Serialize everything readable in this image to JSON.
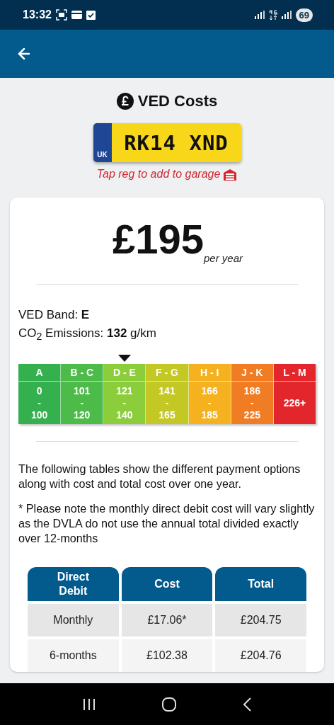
{
  "status_bar": {
    "time": "13:32",
    "battery": "69"
  },
  "header": {
    "title": "VED Costs",
    "registration": "RK14 XND",
    "country": "UK",
    "hint": "Tap reg to add to garage"
  },
  "price": {
    "amount": "£195",
    "period": "per year"
  },
  "band_info": {
    "band": "VED Band: **E**",
    "emissions": "CO$_{2}$ Emissions: **132** g/km"
  },
  "bands": [
    {
      "label": "A",
      "from": "0",
      "dash": "-",
      "to": "100",
      "color": "#35b04f",
      "selected": false
    },
    {
      "label": "B - C",
      "from": "101",
      "dash": "-",
      "to": "120",
      "color": "#4dbb4a",
      "selected": false
    },
    {
      "label": "D - E",
      "from": "121",
      "dash": "-",
      "to": "140",
      "color": "#8ccd3c",
      "selected": true
    },
    {
      "label": "F - G",
      "from": "141",
      "dash": "-",
      "to": "165",
      "color": "#c4c824",
      "selected": false
    },
    {
      "label": "H - I",
      "from": "166",
      "dash": "-",
      "to": "185",
      "color": "#f5b21e",
      "selected": false
    },
    {
      "label": "J - K",
      "from": "186",
      "dash": "-",
      "to": "225",
      "color": "#f07c24",
      "selected": false
    },
    {
      "label": "L - M",
      "value": "226+",
      "color": "#e3262b",
      "selected": false
    }
  ],
  "notes": [
    "The following tables show the different payment options along with cost and total cost over one year.",
    "* Please note the monthly direct debit cost will vary slightly as the DVLA do not use the annual total divided exactly over 12-months"
  ],
  "table": {
    "columns": [
      "Direct Debit",
      "Cost",
      "Total"
    ],
    "rows": [
      [
        "Monthly",
        "£17.06*",
        "£204.75"
      ],
      [
        "6-months",
        "£102.38",
        "£204.76"
      ]
    ]
  }
}
